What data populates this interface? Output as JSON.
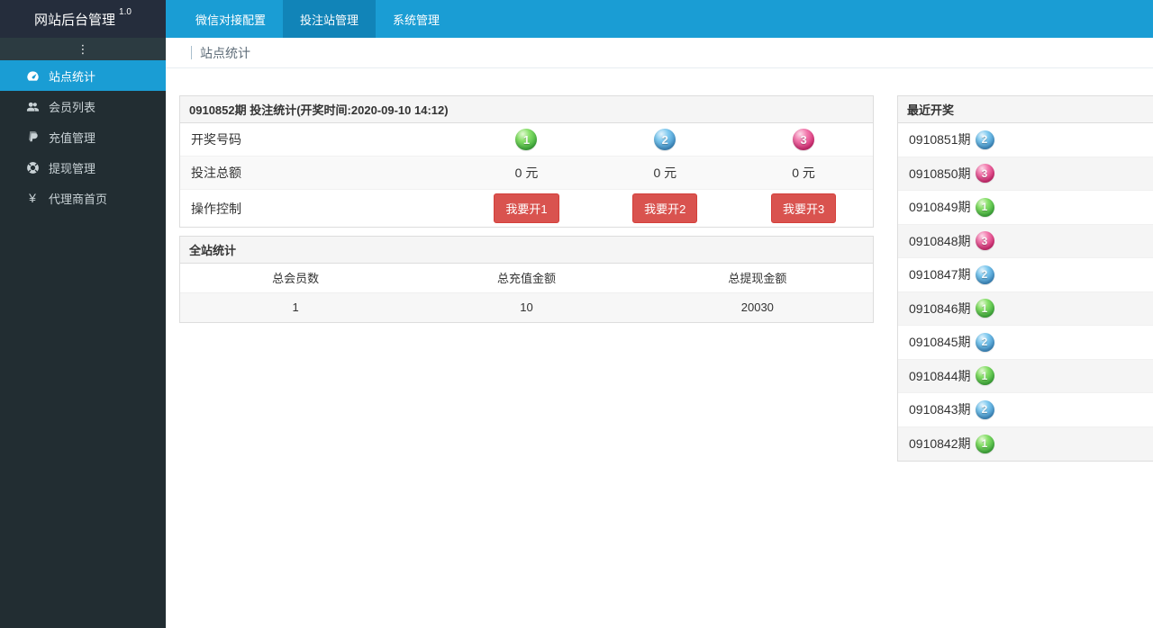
{
  "navbar": {
    "brand": "网站后台管理",
    "version": "1.0",
    "tabs": [
      {
        "label": "微信对接配置",
        "active": false
      },
      {
        "label": "投注站管理",
        "active": true
      },
      {
        "label": "系统管理",
        "active": false
      }
    ]
  },
  "sidebar": {
    "toggle_icon": "⋮",
    "items": [
      {
        "label": "站点统计",
        "icon": "dashboard-icon",
        "active": true
      },
      {
        "label": "会员列表",
        "icon": "users-icon",
        "active": false
      },
      {
        "label": "充值管理",
        "icon": "paypal-icon",
        "active": false
      },
      {
        "label": "提现管理",
        "icon": "life-ring-icon",
        "active": false
      },
      {
        "label": "代理商首页",
        "icon": "yen-icon",
        "active": false
      }
    ],
    "yen_glyph": "¥"
  },
  "breadcrumb": {
    "title": "站点统计"
  },
  "bet_panel": {
    "title": "0910852期 投注统计(开奖时间:2020-09-10 14:12)",
    "labels": {
      "numbers": "开奖号码",
      "amounts": "投注总额",
      "controls": "操作控制"
    },
    "balls": [
      {
        "number": "1",
        "color": "green"
      },
      {
        "number": "2",
        "color": "blue"
      },
      {
        "number": "3",
        "color": "pink"
      }
    ],
    "amounts": [
      "0 元",
      "0 元",
      "0 元"
    ],
    "buttons": [
      "我要开1",
      "我要开2",
      "我要开3"
    ]
  },
  "site_stats": {
    "title": "全站统计",
    "columns": [
      "总会员数",
      "总充值金额",
      "总提现金额"
    ],
    "values": [
      "1",
      "10",
      "20030"
    ]
  },
  "recent_draws": {
    "title": "最近开奖",
    "items": [
      {
        "period": "0910851期",
        "number": "2",
        "color": "blue"
      },
      {
        "period": "0910850期",
        "number": "3",
        "color": "pink"
      },
      {
        "period": "0910849期",
        "number": "1",
        "color": "green"
      },
      {
        "period": "0910848期",
        "number": "3",
        "color": "pink"
      },
      {
        "period": "0910847期",
        "number": "2",
        "color": "blue"
      },
      {
        "period": "0910846期",
        "number": "1",
        "color": "green"
      },
      {
        "period": "0910845期",
        "number": "2",
        "color": "blue"
      },
      {
        "period": "0910844期",
        "number": "1",
        "color": "green"
      },
      {
        "period": "0910843期",
        "number": "2",
        "color": "blue"
      },
      {
        "period": "0910842期",
        "number": "1",
        "color": "green"
      }
    ]
  },
  "colors": {
    "navbar": "#1a9dd4",
    "navbar_active_tab": "#1184b8",
    "brand_bg": "#252d3c",
    "sidebar_bg": "#222d32",
    "sidebar_active": "#1a9dd4",
    "button_red": "#d9534f",
    "ball_green": "#46b441",
    "ball_blue": "#4595cc",
    "ball_pink": "#d83077"
  }
}
